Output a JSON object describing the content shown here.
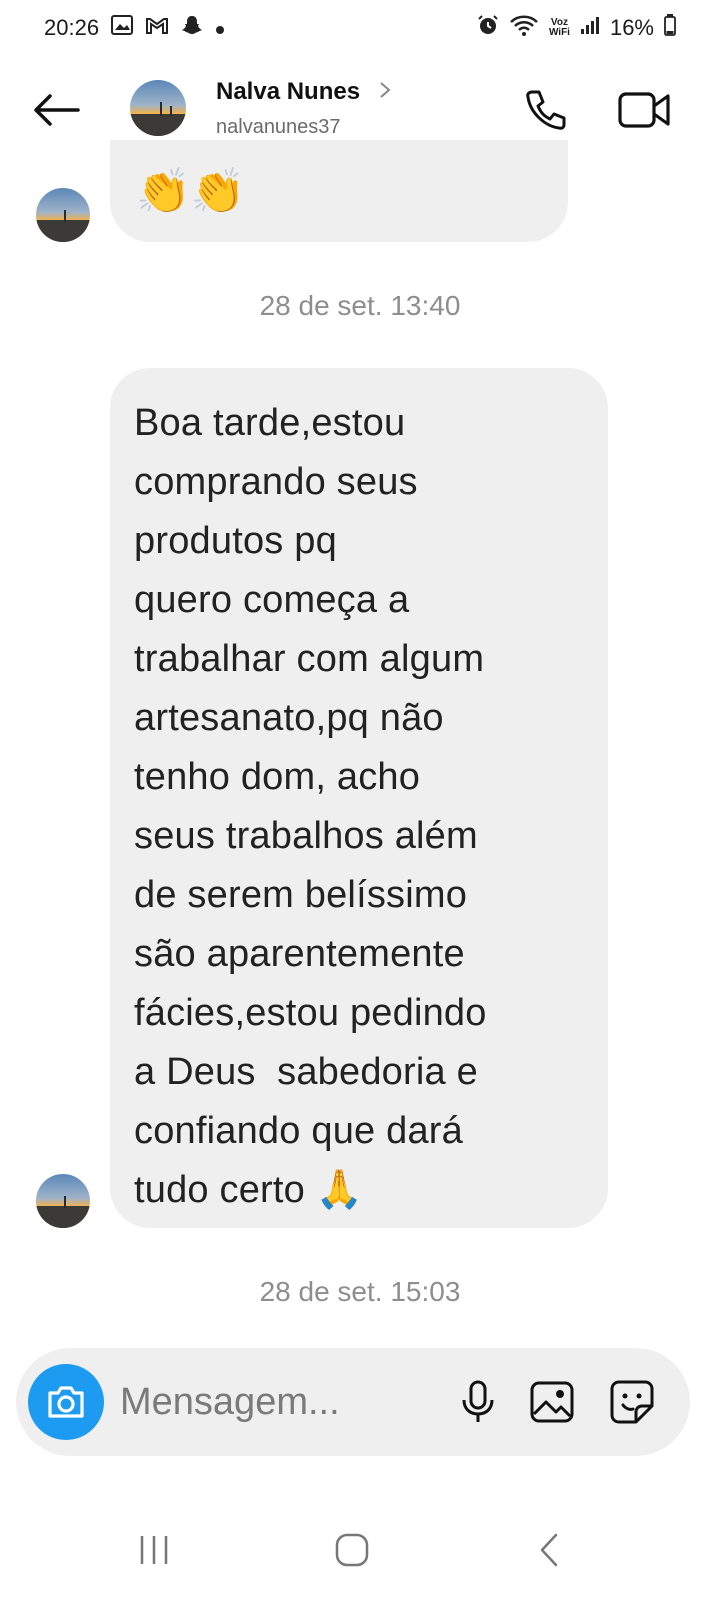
{
  "status_bar": {
    "time": "20:26",
    "voz_label": "Voz",
    "wifi_label": "WiFi",
    "battery": "16%",
    "icons": [
      "gallery-icon",
      "gmail-icon",
      "snapchat-icon",
      "dot-icon",
      "alarm-icon",
      "wifi-calling-icon",
      "signal-icon",
      "battery-icon"
    ]
  },
  "header": {
    "contact_name": "Nalva Nunes",
    "username": "nalvanunes37",
    "icons": [
      "back-arrow-icon",
      "chevron-right-icon",
      "phone-icon",
      "video-camera-icon"
    ]
  },
  "thread": {
    "messages": [
      {
        "text": "👏👏"
      },
      {
        "text": "Boa tarde,estou\ncomprando seus\nprodutos pq\nquero começa a\ntrabalhar com algum\nartesanato,pq não\ntenho dom, acho\nseus trabalhos além\nde serem belíssimo\nsão aparentemente\nfácies,estou pedindo\na Deus  sabedoria e\nconfiando que dará\ntudo certo 🙏"
      }
    ],
    "timestamps": [
      "28 de set. 13:40",
      "28 de set. 15:03"
    ]
  },
  "composer": {
    "placeholder": "Mensagem...",
    "icons": [
      "camera-icon",
      "microphone-icon",
      "image-gallery-icon",
      "sticker-icon"
    ],
    "accent_color": "#1d9bf0"
  },
  "navbar": {
    "icons": [
      "recent-apps-icon",
      "home-icon",
      "nav-back-icon"
    ]
  },
  "colors": {
    "bubble": "#efeff0",
    "timestamp": "#8e8e8e",
    "background": "#ffffff"
  }
}
